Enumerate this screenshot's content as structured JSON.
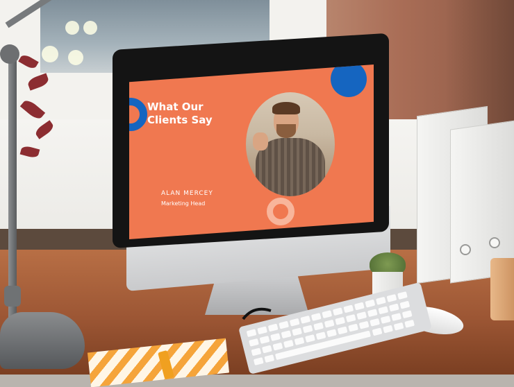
{
  "slide": {
    "title": "What Our Clients Say",
    "person_name": "ALAN MERCEY",
    "person_role": "Marketing Head"
  },
  "colors": {
    "slide_background": "#f07850",
    "accent_blue": "#1565c0",
    "accent_peach": "#f8b59b",
    "desk_wood": "#9c5634"
  }
}
